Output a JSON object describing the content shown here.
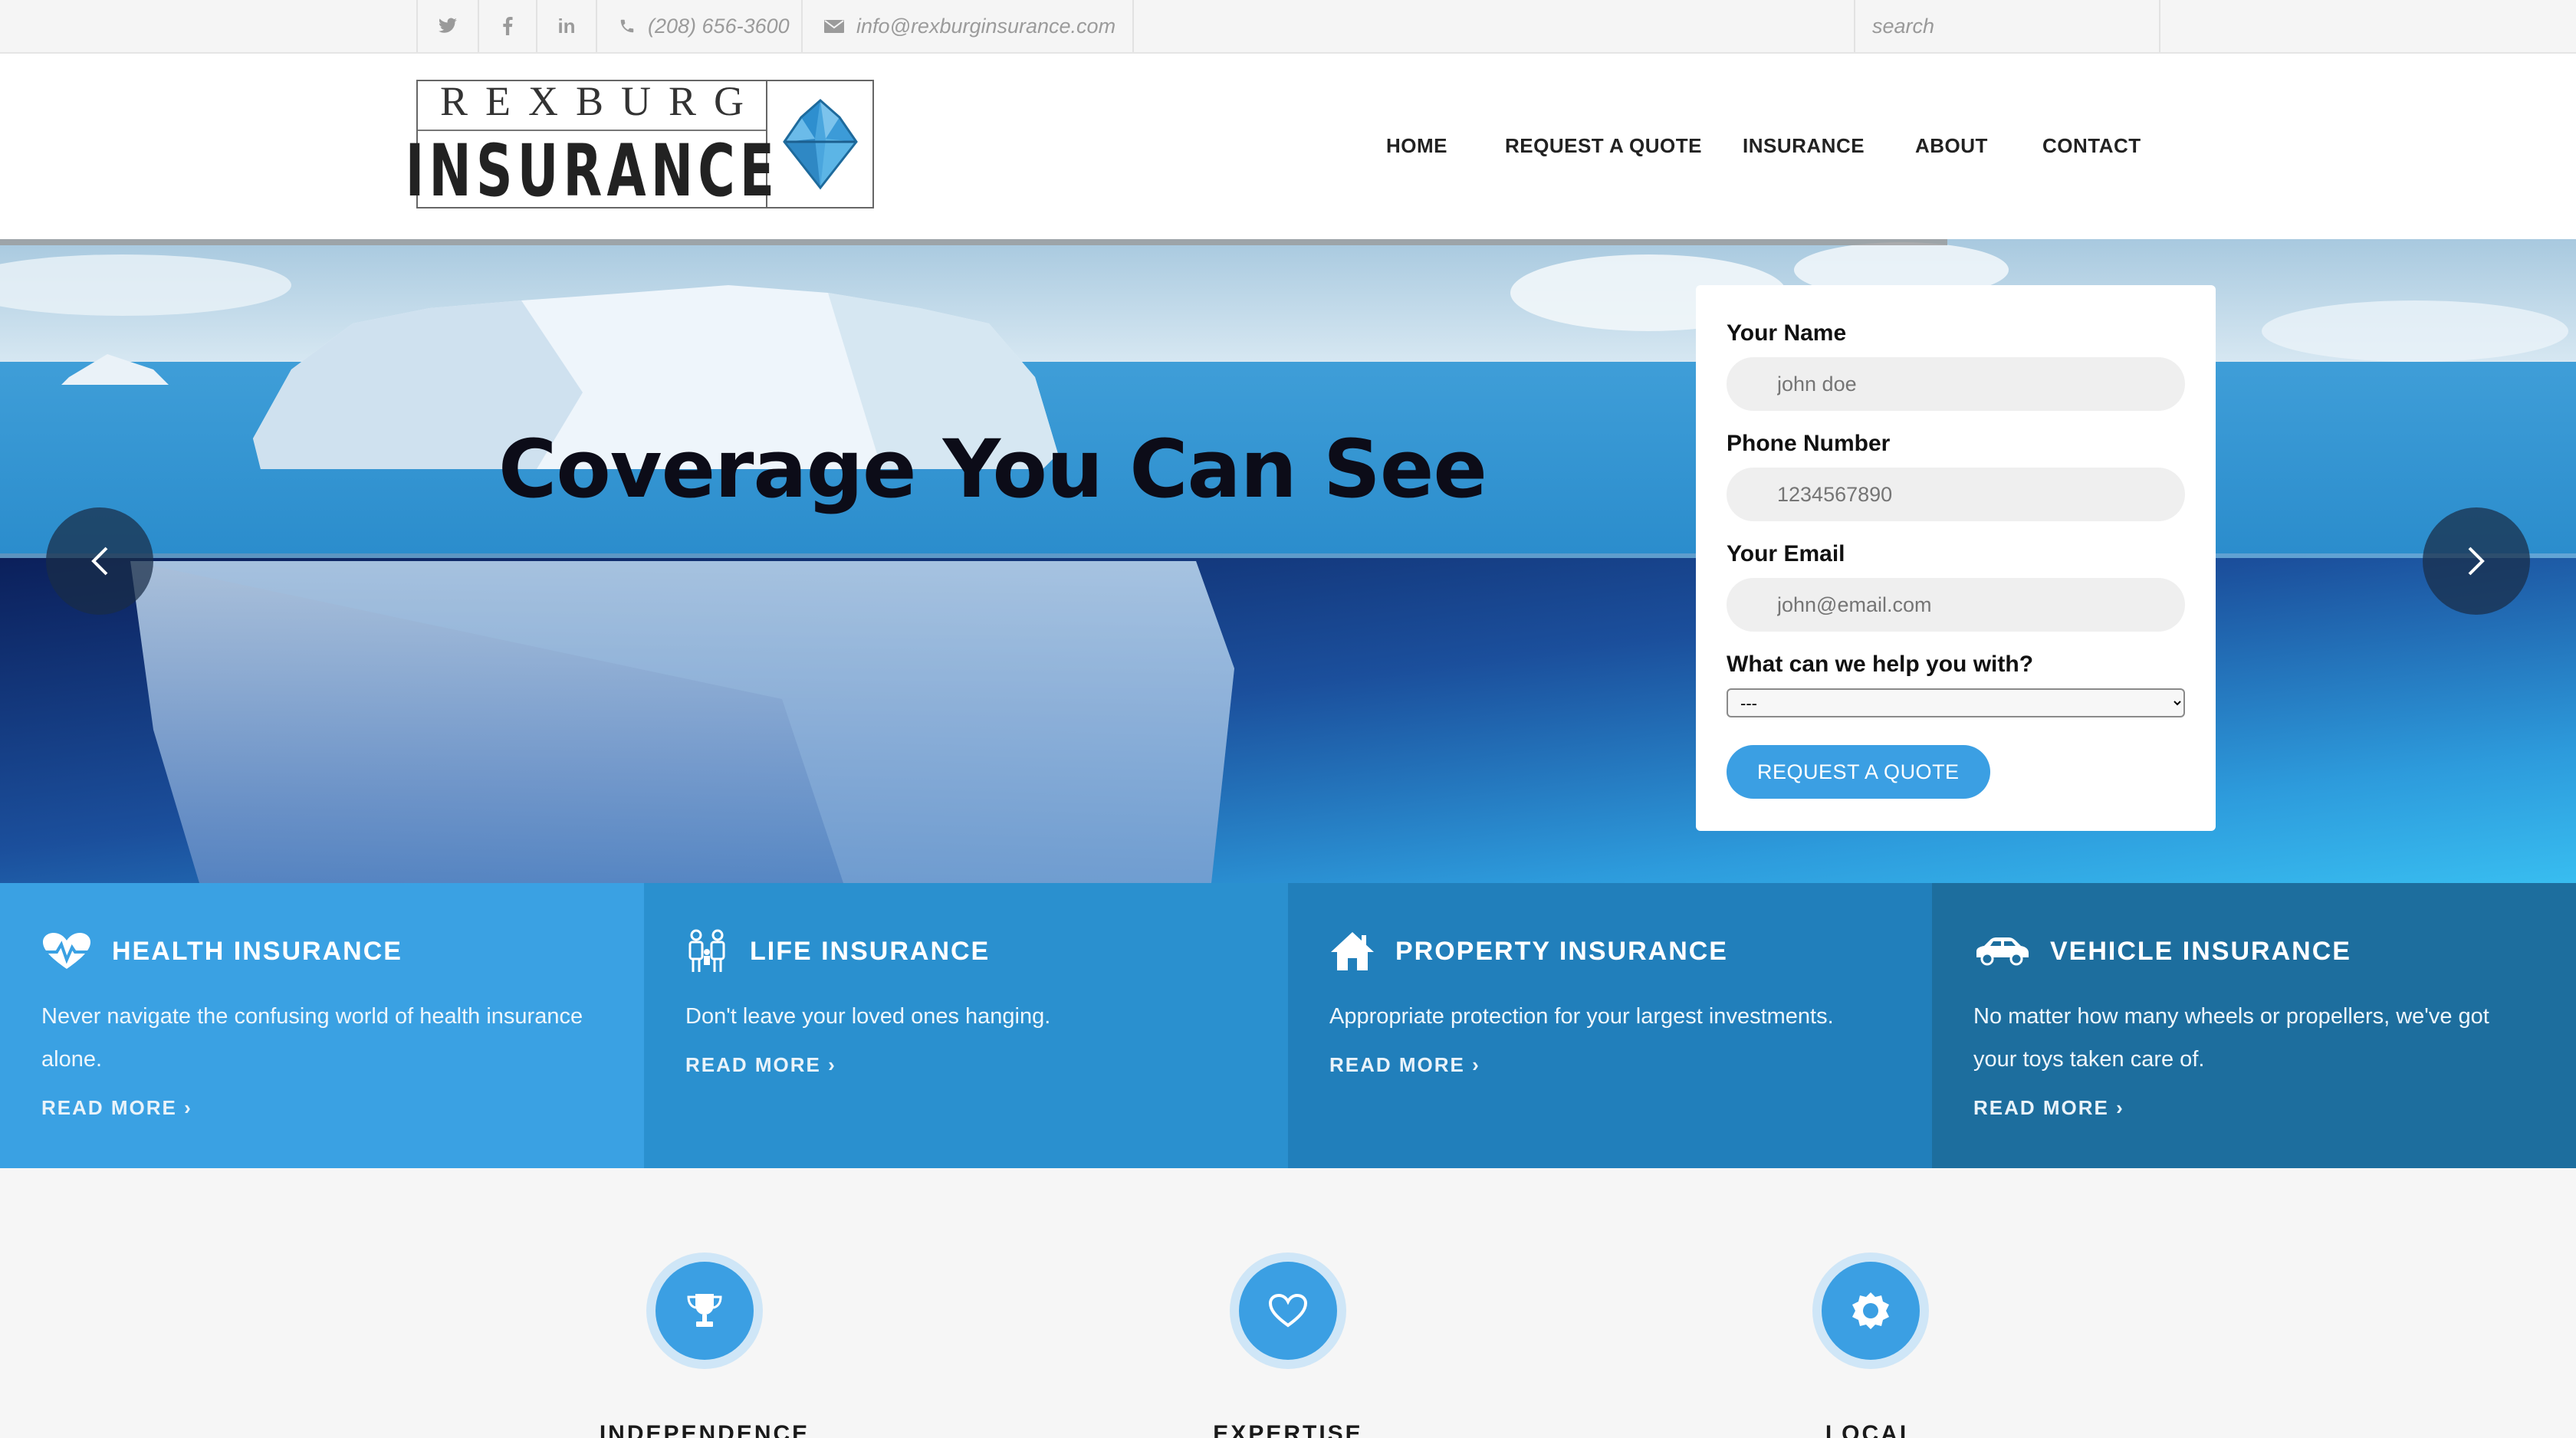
{
  "topbar": {
    "social": [
      {
        "name": "twitter",
        "glyph": "𝕥"
      },
      {
        "name": "facebook",
        "glyph": "f"
      },
      {
        "name": "linkedin",
        "glyph": "in"
      }
    ],
    "phone": "(208) 656-3600",
    "email": "info@rexburginsurance.com",
    "search_placeholder": "search"
  },
  "logo": {
    "top": "REXBURG",
    "bottom": "INSURANCE"
  },
  "nav": [
    "HOME",
    "REQUEST A QUOTE",
    "INSURANCE",
    "ABOUT",
    "CONTACT"
  ],
  "hero": {
    "headline": "Coverage You Can See"
  },
  "quote_form": {
    "name_label": "Your Name",
    "name_placeholder": "john doe",
    "phone_label": "Phone Number",
    "phone_placeholder": "1234567890",
    "email_label": "Your Email",
    "email_placeholder": "john@email.com",
    "help_label": "What can we help you with?",
    "help_selected": "---",
    "submit_label": "REQUEST A QUOTE"
  },
  "tiles": [
    {
      "title": "HEALTH INSURANCE",
      "desc": "Never navigate the confusing world of health insurance alone.",
      "more": "READ MORE ›",
      "color": "#3aa1e3",
      "icon": "heartbeat-icon"
    },
    {
      "title": "LIFE INSURANCE",
      "desc": "Don't leave your loved ones hanging.",
      "more": "READ MORE ›",
      "color": "#2a90cf",
      "icon": "family-icon"
    },
    {
      "title": "PROPERTY INSURANCE",
      "desc": "Appropriate protection for your largest investments.",
      "more": "READ MORE ›",
      "color": "#217fbb",
      "icon": "house-icon"
    },
    {
      "title": "VEHICLE INSURANCE",
      "desc": "No matter how many wheels or propellers, we've got your toys taken care of.",
      "more": "READ MORE ›",
      "color": "#1d6e9e",
      "icon": "car-icon"
    }
  ],
  "values": [
    {
      "label": "INDEPENDENCE",
      "icon": "trophy-icon"
    },
    {
      "label": "EXPERTISE",
      "icon": "heart-icon"
    },
    {
      "label": "LOCAL",
      "icon": "badge-icon"
    }
  ],
  "colors": {
    "accent": "#3b9fe3"
  }
}
